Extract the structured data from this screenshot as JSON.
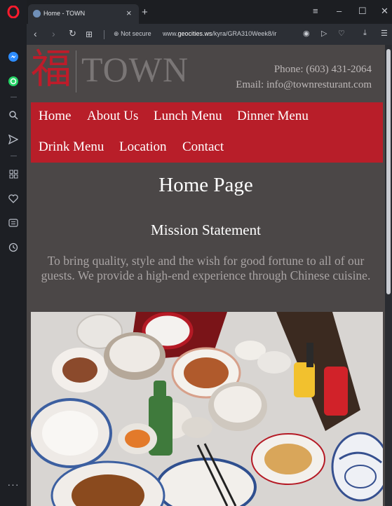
{
  "browser": {
    "tab_title": "Home - TOWN",
    "url_security": "Not secure",
    "url_prefix": "www.",
    "url_domain": "geocities.ws",
    "url_path": "/kyra/GRA310Week8/ir"
  },
  "site": {
    "logo_char": "福",
    "logo_text": "TOWN",
    "phone": "Phone: (603) 431-2064",
    "email": "Email: info@townresturant.com",
    "nav": [
      "Home",
      "About Us",
      "Lunch Menu",
      "Dinner Menu",
      "Drink Menu",
      "Location",
      "Contact"
    ],
    "page_title": "Home Page",
    "mission_title": "Mission Statement",
    "mission_text": "To bring quality, style and the wish for good fortune to all of our guests. We provide a high-end experience through Chinese cuisine."
  },
  "icons": {
    "sidebar": [
      "opera-logo-icon",
      "messenger-icon",
      "whatsapp-icon",
      "search-icon",
      "send-icon",
      "speed-dial-icon",
      "heart-icon",
      "news-icon",
      "history-icon",
      "more-icon"
    ]
  },
  "colors": {
    "nav_red": "#b81e29",
    "page_bg": "#4b4747",
    "logo_red": "#be1c2a"
  }
}
